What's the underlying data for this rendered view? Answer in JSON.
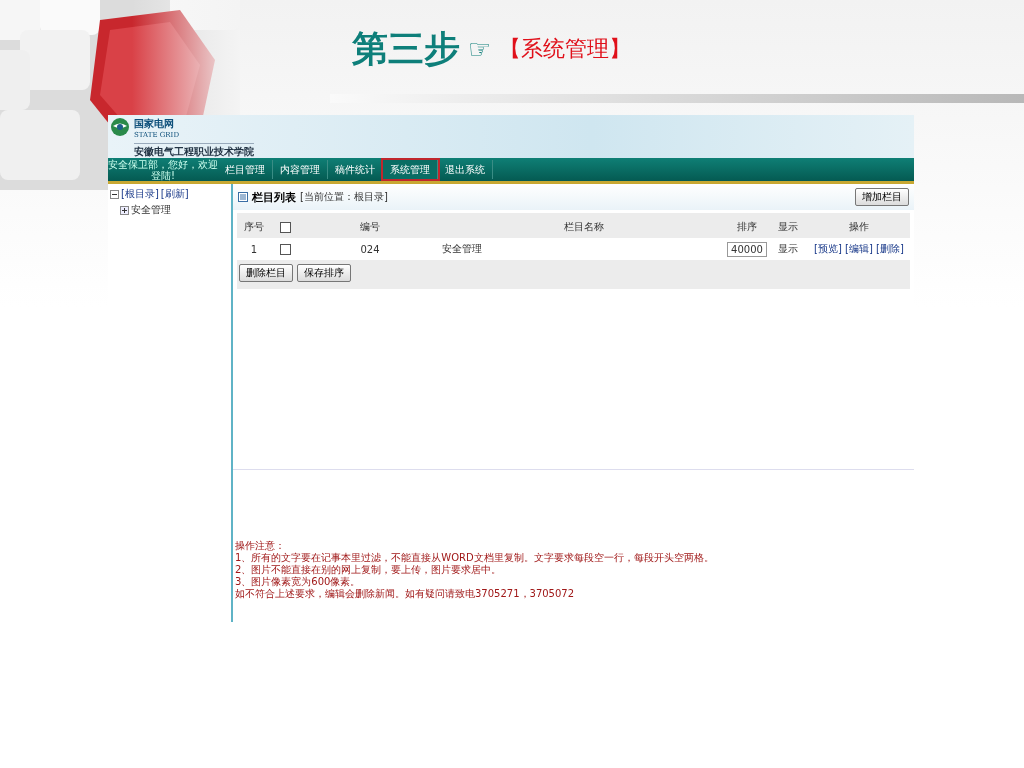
{
  "slide": {
    "title": "第三步",
    "pointer": "☞",
    "subtitle": "【系统管理】"
  },
  "app": {
    "logo": {
      "name_cn": "国家电网",
      "name_en": "STATE GRID",
      "school": "安徽电气工程职业技术学院"
    },
    "greeting": "安全保卫部，您好，欢迎登陆!",
    "nav": [
      {
        "label": "栏目管理",
        "selected": false
      },
      {
        "label": "内容管理",
        "selected": false
      },
      {
        "label": "稿件统计",
        "selected": false
      },
      {
        "label": "系统管理",
        "selected": true
      },
      {
        "label": "退出系统",
        "selected": false
      }
    ],
    "tree": {
      "root": "[根目录]",
      "refresh": "[刷新]",
      "expanded": true,
      "children": [
        {
          "label": "安全管理",
          "expanded": false
        }
      ]
    },
    "panel": {
      "title": "栏目列表",
      "location": "[当前位置：根目录]",
      "add_button": "增加栏目"
    },
    "table": {
      "columns": [
        {
          "kind": "text",
          "label": "序号"
        },
        {
          "kind": "checkbox",
          "checked": false
        },
        {
          "kind": "text",
          "label": "编号"
        },
        {
          "kind": "text",
          "label": "栏目名称"
        },
        {
          "kind": "text",
          "label": "排序"
        },
        {
          "kind": "text",
          "label": "显示"
        },
        {
          "kind": "text",
          "label": "操作"
        }
      ],
      "rows": [
        {
          "index": "1",
          "checked": false,
          "code": "024",
          "name": "安全管理",
          "order": "40000",
          "display": "显示",
          "actions": [
            "[预览]",
            "[编辑]",
            "[删除]"
          ]
        }
      ]
    },
    "buttons": [
      "删除栏目",
      "保存排序"
    ],
    "notes": {
      "title": "操作注意：",
      "lines": [
        "1、所有的文字要在记事本里过滤，不能直接从WORD文档里复制。文字要求每段空一行，每段开头空两格。",
        "2、图片不能直接在别的网上复制，要上传，图片要求居中。",
        "3、图片像素宽为600像素。",
        "如不符合上述要求，编辑会删除新闻。如有疑问请致电3705271，3705072"
      ]
    }
  }
}
